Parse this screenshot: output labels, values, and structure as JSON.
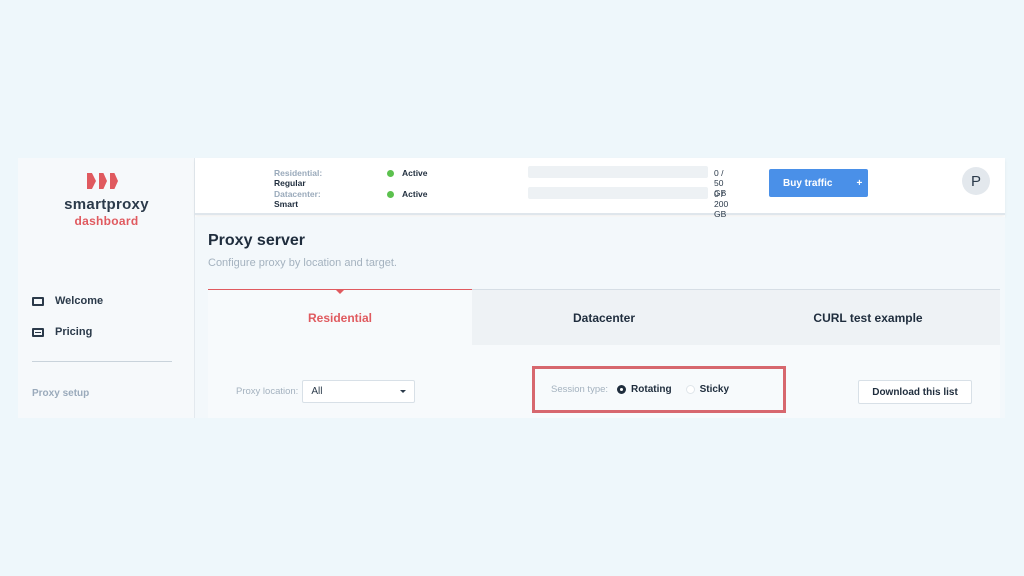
{
  "brand": {
    "name": "smartproxy",
    "subtitle": "dashboard",
    "accent": "#e05a5f"
  },
  "sidebar": {
    "items": [
      {
        "label": "Welcome",
        "icon": "monitor-icon"
      },
      {
        "label": "Pricing",
        "icon": "credit-card-icon"
      }
    ],
    "section_label": "Proxy setup"
  },
  "topbar": {
    "plans": [
      {
        "label": "Residential:",
        "plan": "Regular",
        "status": "Active",
        "usage": "0 / 50 GB"
      },
      {
        "label": "Datacenter:",
        "plan": "Smart",
        "status": "Active",
        "usage": "0 / 200 GB"
      }
    ],
    "buy_button": "Buy traffic",
    "buy_icon": "+",
    "avatar_initial": "P",
    "status_color": "#5cc14e",
    "button_color": "#4a90e8"
  },
  "main": {
    "title": "Proxy server",
    "subtitle": "Configure proxy by location and target.",
    "tabs": [
      {
        "label": "Residential",
        "active": true
      },
      {
        "label": "Datacenter",
        "active": false
      },
      {
        "label": "CURL test example",
        "active": false
      }
    ],
    "proxy_location": {
      "label": "Proxy location:",
      "value": "All"
    },
    "session_type": {
      "label": "Session type:",
      "options": [
        "Rotating",
        "Sticky"
      ],
      "selected": "Rotating"
    },
    "download_button": "Download this list"
  }
}
